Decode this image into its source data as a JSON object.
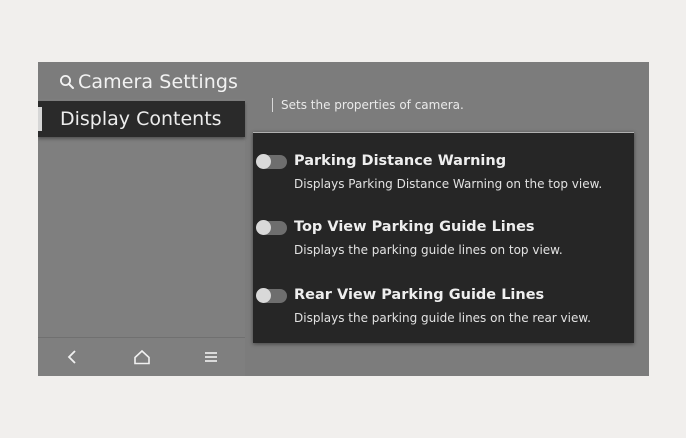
{
  "header": {
    "title": "Camera Settings",
    "icon": "search-icon"
  },
  "sidebar": {
    "items": [
      {
        "label": "Display Contents",
        "selected": true
      }
    ]
  },
  "bottom_nav": {
    "items": [
      {
        "icon": "back-icon"
      },
      {
        "icon": "home-icon"
      },
      {
        "icon": "menu-icon"
      }
    ]
  },
  "main": {
    "description": "Sets the properties of camera.",
    "options": [
      {
        "title": "Parking Distance Warning",
        "description": "Displays Parking Distance Warning on the top view.",
        "enabled": false
      },
      {
        "title": "Top View Parking Guide Lines",
        "description": "Displays the parking guide lines on top view.",
        "enabled": false
      },
      {
        "title": "Rear View Parking Guide Lines",
        "description": "Displays the parking guide lines on the rear view.",
        "enabled": false
      }
    ]
  },
  "colors": {
    "screen_bg": "#7c7c7c",
    "panel_bg": "#262626",
    "selected_item_bg": "#2a2a2a",
    "text": "#eeeeee",
    "toggle_off_track": "#6e6e6e",
    "toggle_knob": "#d9d9d9"
  }
}
